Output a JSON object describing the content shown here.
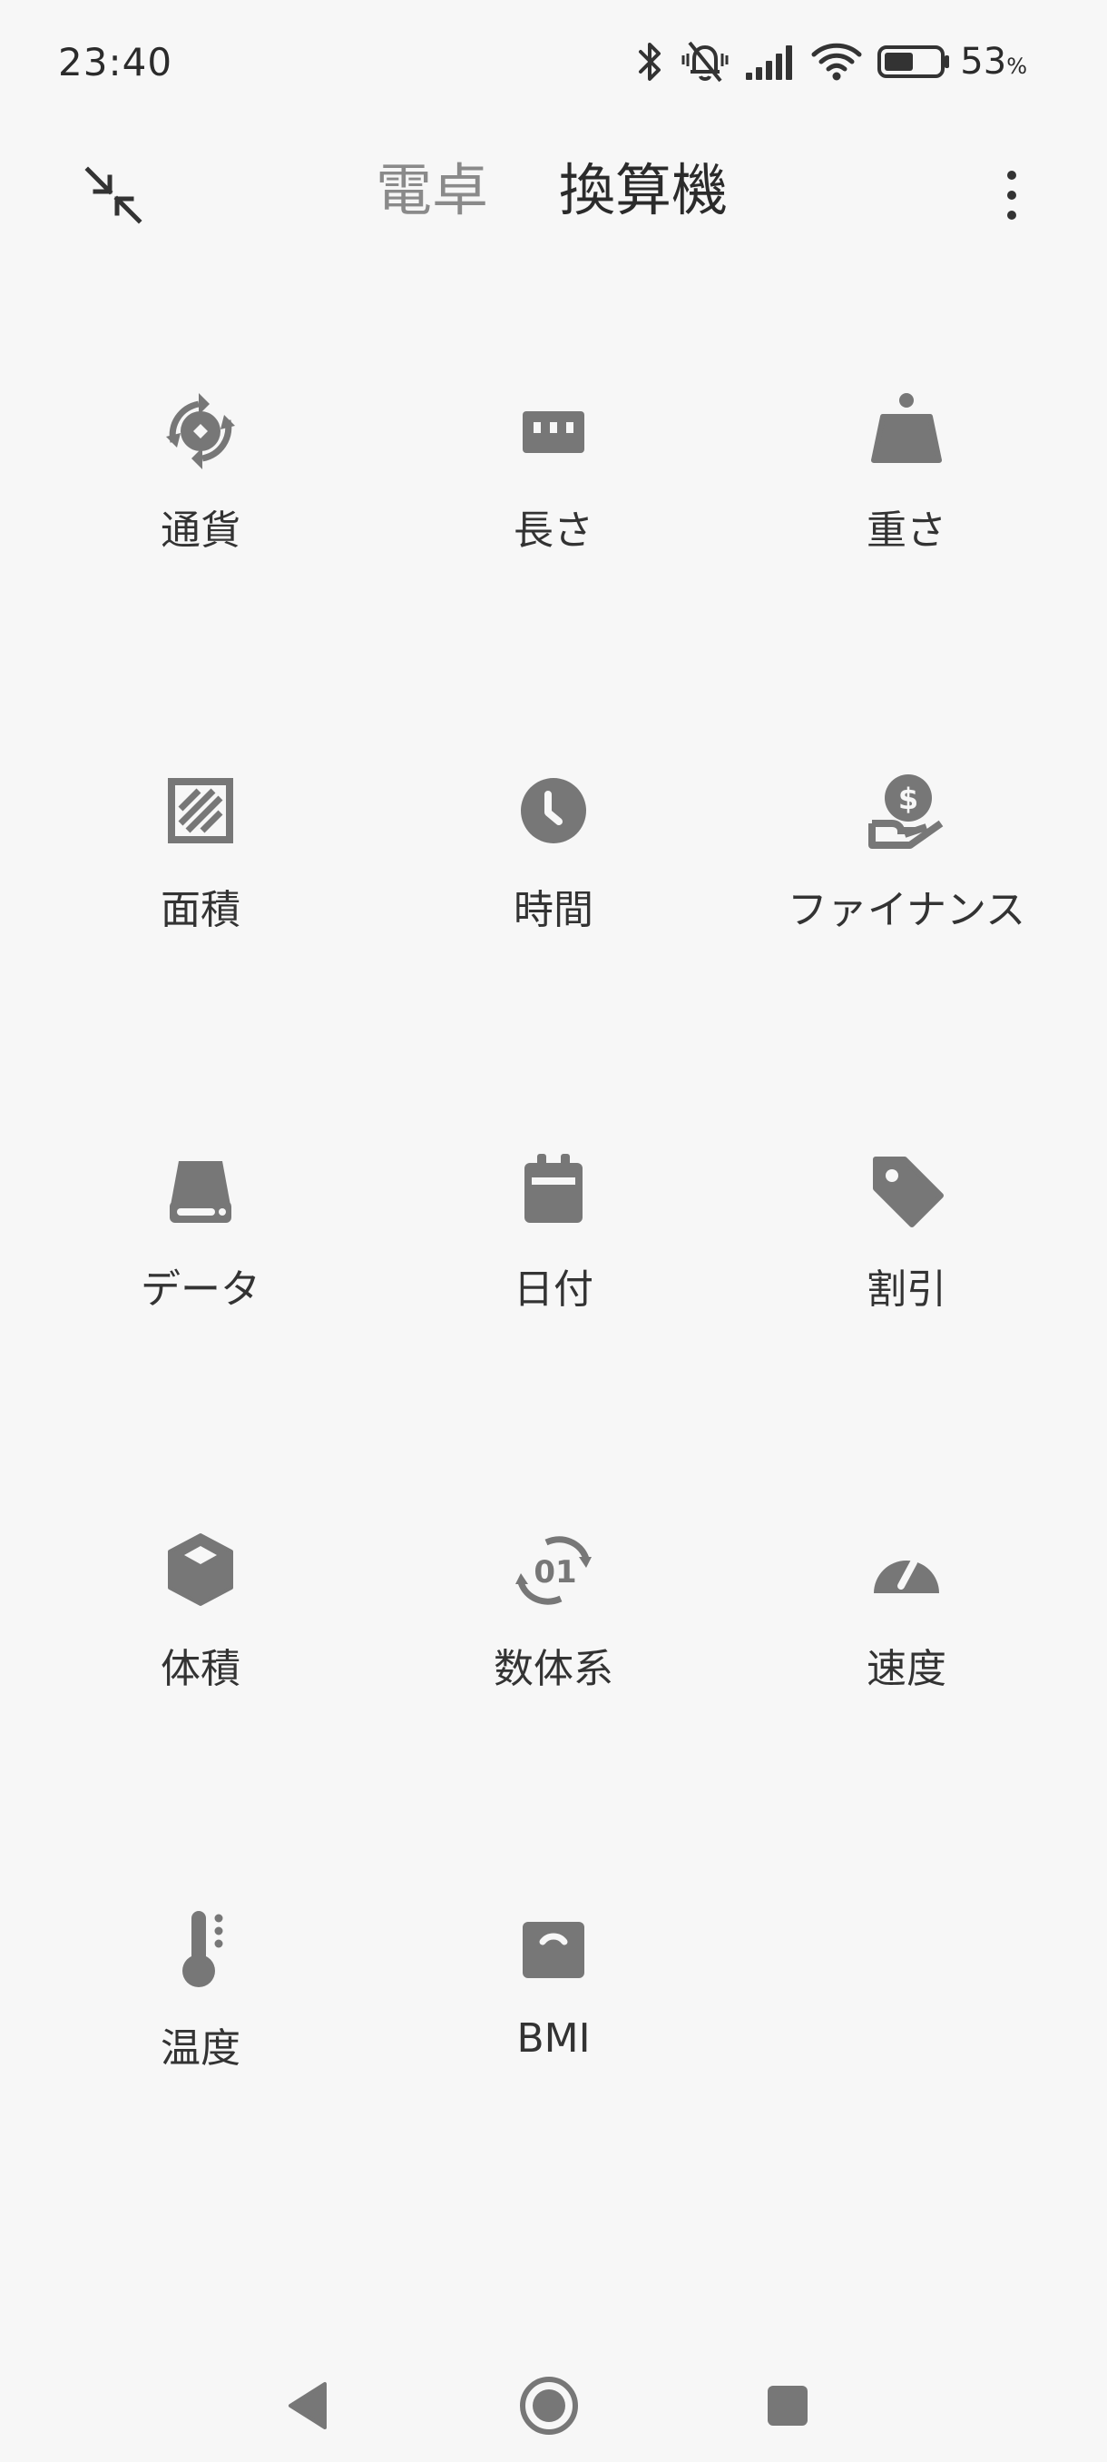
{
  "status_bar": {
    "time": "23:40",
    "battery_percent": "53",
    "battery_unit": "%",
    "battery_level": 0.53,
    "icons": [
      "bluetooth-icon",
      "bell-off-icon",
      "signal-icon",
      "wifi-icon",
      "battery-icon"
    ]
  },
  "header": {
    "tab_calculator": "電卓",
    "tab_converter": "換算機",
    "active_tab": "換算機",
    "collapse_icon": "collapse-arrows-icon",
    "menu_icon": "more-vert-icon"
  },
  "converters": [
    {
      "label": "通貨",
      "icon": "currency-icon"
    },
    {
      "label": "長さ",
      "icon": "length-icon"
    },
    {
      "label": "重さ",
      "icon": "weight-icon"
    },
    {
      "label": "面積",
      "icon": "area-icon"
    },
    {
      "label": "時間",
      "icon": "clock-icon"
    },
    {
      "label": "ファイナンス",
      "icon": "finance-icon"
    },
    {
      "label": "データ",
      "icon": "storage-icon"
    },
    {
      "label": "日付",
      "icon": "calendar-icon"
    },
    {
      "label": "割引",
      "icon": "tag-icon"
    },
    {
      "label": "体積",
      "icon": "cube-icon"
    },
    {
      "label": "数体系",
      "icon": "number-system-icon"
    },
    {
      "label": "速度",
      "icon": "speedometer-icon"
    },
    {
      "label": "温度",
      "icon": "thermometer-icon"
    },
    {
      "label": "BMI",
      "icon": "scale-icon"
    }
  ],
  "colors": {
    "background": "#f7f7f7",
    "icon": "#777777",
    "text": "#333333",
    "inactive_tab": "#8a8a8a"
  },
  "nav_bar": {
    "icons": [
      "back-icon",
      "home-icon",
      "recents-icon"
    ]
  }
}
